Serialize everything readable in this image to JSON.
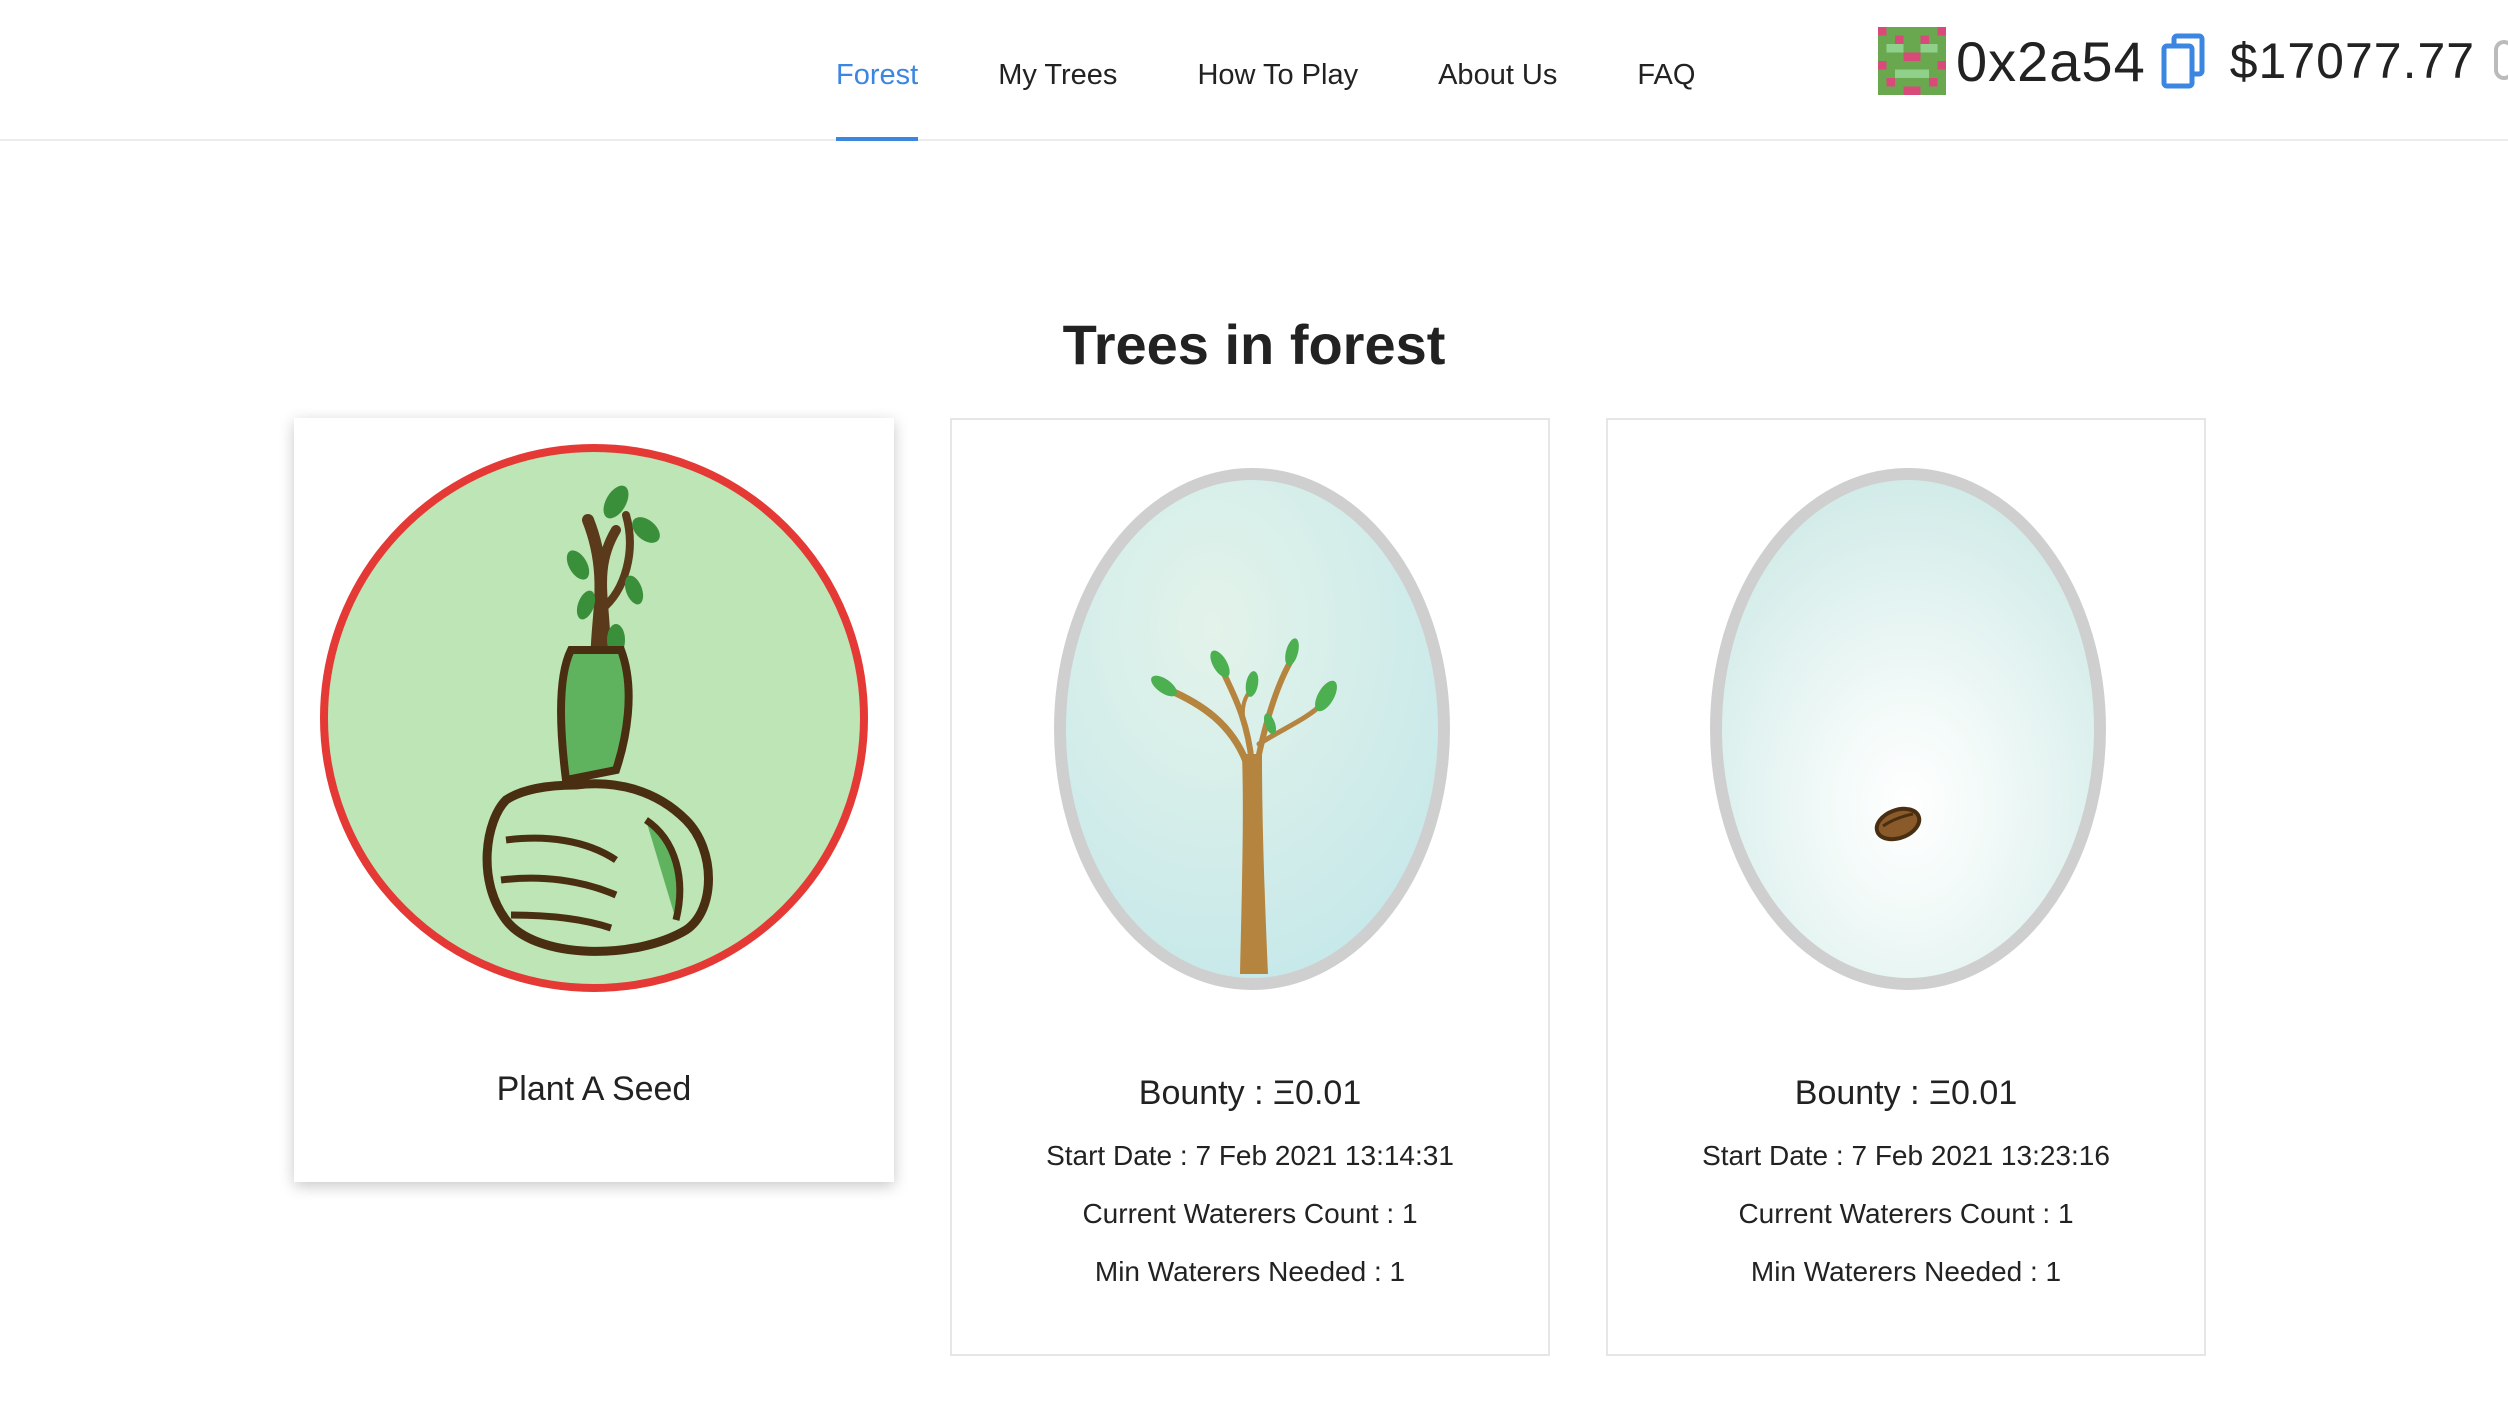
{
  "nav": {
    "tabs": [
      {
        "label": "Forest",
        "active": true
      },
      {
        "label": "My Trees",
        "active": false
      },
      {
        "label": "How To Play",
        "active": false
      },
      {
        "label": "About Us",
        "active": false
      },
      {
        "label": "FAQ",
        "active": false
      }
    ]
  },
  "account": {
    "avatar_icon": "pixel-identicon",
    "address": "0x2a54",
    "copy_icon": "copy-icon",
    "balance": "$17077.77"
  },
  "main": {
    "title": "Trees in forest",
    "plant_card": {
      "label": "Plant A Seed",
      "icon": "thumbs-up-sprout-icon"
    },
    "trees": [
      {
        "stage_icon": "sapling-icon",
        "bounty": "Bounty : Ξ0.01",
        "start_date": "Start Date : 7 Feb 2021 13:14:31",
        "waterers": "Current Waterers Count : 1",
        "min_waterers": "Min Waterers Needed : 1"
      },
      {
        "stage_icon": "seed-icon",
        "bounty": "Bounty : Ξ0.01",
        "start_date": "Start Date : 7 Feb 2021 13:23:16",
        "waterers": "Current Waterers Count : 1",
        "min_waterers": "Min Waterers Needed : 1"
      }
    ]
  },
  "colors": {
    "accent": "#3b86e0",
    "plant_ring": "#e53935",
    "plant_fill": "#bde5b5",
    "text": "#222222"
  }
}
